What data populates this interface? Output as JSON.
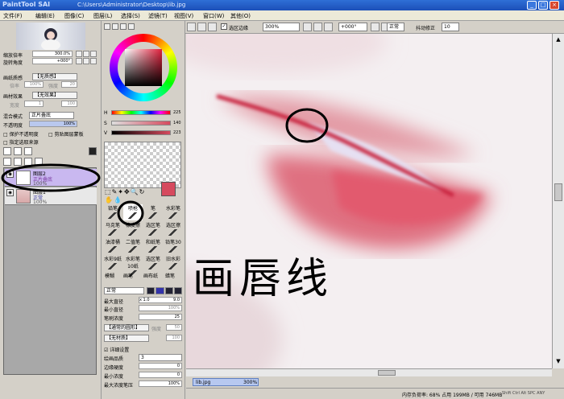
{
  "window": {
    "logo": "PaintTool SAI",
    "path": "C:\\Users\\Administrator\\Desktop\\lib.jpg",
    "min": "_",
    "max": "□",
    "close": "×"
  },
  "menu": [
    "文件(F)",
    "编辑(E)",
    "图像(C)",
    "图层(L)",
    "选择(S)",
    "滤镜(T)",
    "视图(V)",
    "窗口(W)",
    "其他(O)"
  ],
  "toolbar": {
    "selection_check": "选区边缘",
    "zoom": "300%",
    "rotation": "+000°",
    "blend": "正常",
    "stabilizer_label": "抖动修正",
    "stabilizer_value": "10"
  },
  "navigator": {
    "zoom_label": "缩放倍率",
    "zoom_value": "300.0%",
    "angle_label": "旋转角度",
    "angle_value": "+000°"
  },
  "layer_props": {
    "paper_label": "画纸质感",
    "paper_value": "【无质感】",
    "scale_label": "倍率",
    "scale_value": "100%",
    "strength_label": "强度",
    "strength_value": "20",
    "effect_label": "画材效果",
    "effect_value": "【无效果】",
    "width_label": "宽度",
    "width_value": "1",
    "effect_strength_value": "100",
    "blend_label": "混合模式",
    "blend_value": "正片叠底",
    "opacity_label": "不透明度",
    "opacity_value": "100%",
    "protect": "保护不透明度",
    "clip": "剪贴图层蒙板",
    "selection_source": "指定选取来源"
  },
  "layers": [
    {
      "name": "图层2",
      "mode": "正片叠底",
      "opacity": "100%"
    },
    {
      "name": "图层1",
      "mode": "正常",
      "opacity": "100%"
    }
  ],
  "color": {
    "h_label": "H",
    "h_value": "225",
    "s_label": "S",
    "s_value": "140",
    "v_label": "V",
    "v_value": "223",
    "fg": "#d64a5e",
    "bg": "#ffffff"
  },
  "tools": [
    "铅笔",
    "喷枪",
    "笔",
    "水彩笔",
    "马克笔",
    "橡皮擦",
    "选区笔",
    "选区擦",
    "油漆桶",
    "二值笔",
    "和纸笔",
    "铅笔30",
    "水彩9纸",
    "水彩笔10纸",
    "选区笔",
    "旧水彩",
    "模糊",
    "画笔",
    "画布纸",
    "蜡笔"
  ],
  "brush": {
    "mode": "正常",
    "size_label": "最大直径",
    "size_mult": "x 1.0",
    "size_value": "9.0",
    "min_label": "最小直径",
    "min_value": "100%",
    "density_label": "笔刷浓度",
    "density_value": "25",
    "shape_value": "【通常的圆形】",
    "shape_strength": "强度",
    "shape_strength_value": "50",
    "texture_value": "【无材质】",
    "texture_strength_value": "100",
    "detail_label": "详细设置",
    "quality_label": "绘画品质",
    "quality_value": "3",
    "edge_label": "边缘硬度",
    "edge_value": "0",
    "min_density_label": "最小浓度",
    "min_density_value": "0",
    "max_pressure_label": "最大浓度笔压",
    "max_pressure_value": "100%"
  },
  "annotation": {
    "text": "画唇线"
  },
  "filetab": {
    "name": "lib.jpg",
    "zoom": "300%"
  },
  "status": {
    "memory": "内存负荷率: 68%  占用 199MB / 可用 746MB",
    "keys": "Shift Ctrl Alt SPC ANY"
  }
}
